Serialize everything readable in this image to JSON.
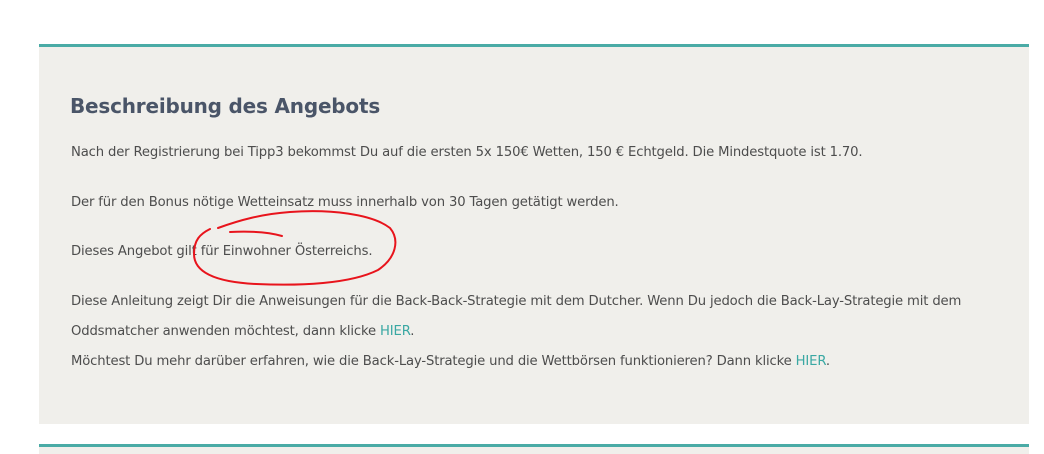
{
  "offer": {
    "heading": "Beschreibung des Angebots",
    "p1": "Nach der Registrierung bei Tipp3 bekommst Du auf die ersten 5x 150€ Wetten, 150 € Echtgeld. Die Mindestquote ist 1.70.",
    "p2": "Der für den Bonus nötige Wetteinsatz muss innerhalb von 30 Tagen getätigt werden.",
    "p3": "Dieses Angebot gilt für Einwohner Österreichs.",
    "p4_line1": "Diese Anleitung zeigt Dir die Anweisungen für die Back-Back-Strategie mit dem Dutcher. Wenn Du jedoch die Back-Lay-Strategie mit dem",
    "p4_line2_text": "Oddsmatcher anwenden möchtest, dann klicke ",
    "p4_link": "HIER",
    "p4_end": ".",
    "p5_text": "Möchtest Du mehr darüber erfahren, wie die Back-Lay-Strategie und die Wettbörsen funktionieren? Dann klicke ",
    "p5_link": "HIER",
    "p5_end": "."
  },
  "colors": {
    "accent": "#4aaba6",
    "box_background": "#f0efeb",
    "heading": "#4a5568",
    "text": "#4d4d4d",
    "link": "#3aa8a3",
    "annotation": "#e8141c"
  }
}
